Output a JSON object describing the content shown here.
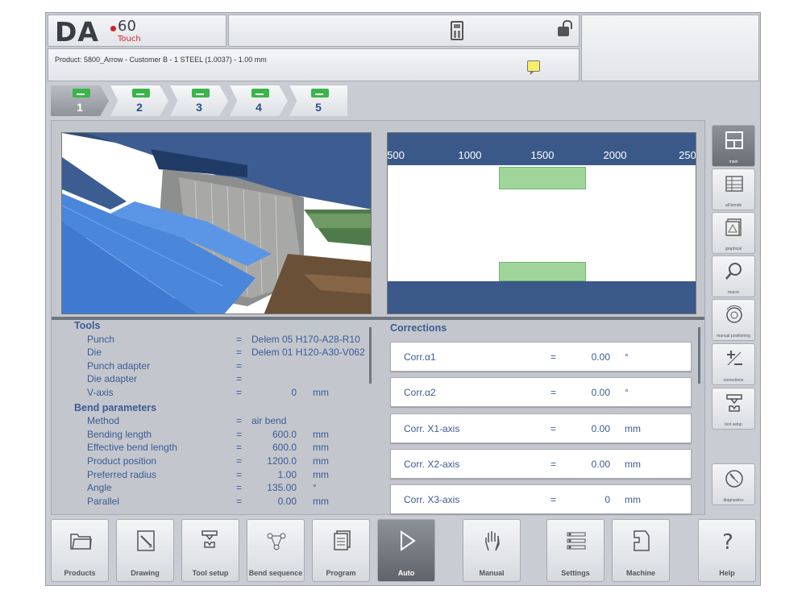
{
  "header": {
    "logo_brand": "DA",
    "logo_model": "60",
    "logo_sub": "Touch",
    "product_line": "Product: 5800_Arrow - Customer B - 1 STEEL (1.0037) - 1.00 mm"
  },
  "bend_tabs": [
    {
      "label": "1",
      "active": true
    },
    {
      "label": "2",
      "active": false
    },
    {
      "label": "3",
      "active": false
    },
    {
      "label": "4",
      "active": false
    },
    {
      "label": "5",
      "active": false
    }
  ],
  "graph": {
    "ticks": [
      "500",
      "1000",
      "1500",
      "2000",
      "250"
    ]
  },
  "tools": {
    "title": "Tools",
    "rows": [
      {
        "label": "Punch",
        "eq": "=",
        "value": "Delem 05 H170-A28-R10",
        "unit": ""
      },
      {
        "label": "Die",
        "eq": "=",
        "value": "Delem 01 H120-A30-V062",
        "unit": ""
      },
      {
        "label": "Punch adapter",
        "eq": "=",
        "value": "",
        "unit": ""
      },
      {
        "label": "Die adapter",
        "eq": "=",
        "value": "",
        "unit": ""
      },
      {
        "label": "V-axis",
        "eq": "=",
        "value": "0",
        "unit": "mm"
      }
    ]
  },
  "bend_params": {
    "title": "Bend parameters",
    "rows": [
      {
        "label": "Method",
        "eq": "=",
        "value": "air bend",
        "unit": ""
      },
      {
        "label": "Bending length",
        "eq": "=",
        "value": "600.0",
        "unit": "mm"
      },
      {
        "label": "Effective bend length",
        "eq": "=",
        "value": "600.0",
        "unit": "mm"
      },
      {
        "label": "Product position",
        "eq": "=",
        "value": "1200.0",
        "unit": "mm"
      },
      {
        "label": "Preferred radius",
        "eq": "=",
        "value": "1.00",
        "unit": "mm"
      },
      {
        "label": "Angle",
        "eq": "=",
        "value": "135.00",
        "unit": "°"
      },
      {
        "label": "Parallel",
        "eq": "=",
        "value": "0.00",
        "unit": "mm"
      }
    ]
  },
  "corrections": {
    "title": "Corrections",
    "rows": [
      {
        "label": "Corr.α1",
        "eq": "=",
        "value": "0.00",
        "unit": "°"
      },
      {
        "label": "Corr.α2",
        "eq": "=",
        "value": "0.00",
        "unit": "°"
      },
      {
        "label": "Corr. X1-axis",
        "eq": "=",
        "value": "0.00",
        "unit": "mm"
      },
      {
        "label": "Corr. X2-axis",
        "eq": "=",
        "value": "0.00",
        "unit": "mm"
      },
      {
        "label": "Corr. X3-axis",
        "eq": "=",
        "value": "0",
        "unit": "mm"
      }
    ]
  },
  "sidebar": [
    {
      "label": "main",
      "icon": "main-view-icon",
      "active": true
    },
    {
      "label": "all bends",
      "icon": "table-icon",
      "active": false
    },
    {
      "label": "graphical",
      "icon": "graphical-icon",
      "active": false
    },
    {
      "label": "macro",
      "icon": "magnifier-icon",
      "active": false
    },
    {
      "label": "manual positioning",
      "icon": "dial-icon",
      "active": false
    },
    {
      "label": "corrections",
      "icon": "plus-minus-icon",
      "active": false
    },
    {
      "label": "tool setup",
      "icon": "tool-setup-icon",
      "active": false
    },
    {
      "label": "diagnostics",
      "icon": "gauge-icon",
      "active": false
    }
  ],
  "bottom_nav": [
    {
      "label": "Products",
      "icon": "folder-icon",
      "active": false
    },
    {
      "label": "Drawing",
      "icon": "drawing-icon",
      "active": false
    },
    {
      "label": "Tool setup",
      "icon": "tool-setup-icon",
      "active": false
    },
    {
      "label": "Bend sequence",
      "icon": "bend-sequence-icon",
      "active": false
    },
    {
      "label": "Program",
      "icon": "program-icon",
      "active": false
    },
    {
      "label": "Auto",
      "icon": "play-icon",
      "active": true
    },
    {
      "label": "Manual",
      "icon": "hand-icon",
      "active": false
    },
    {
      "label": "Settings",
      "icon": "settings-icon",
      "active": false
    },
    {
      "label": "Machine",
      "icon": "machine-icon",
      "active": false
    },
    {
      "label": "Help",
      "icon": "help-icon",
      "active": false
    }
  ]
}
